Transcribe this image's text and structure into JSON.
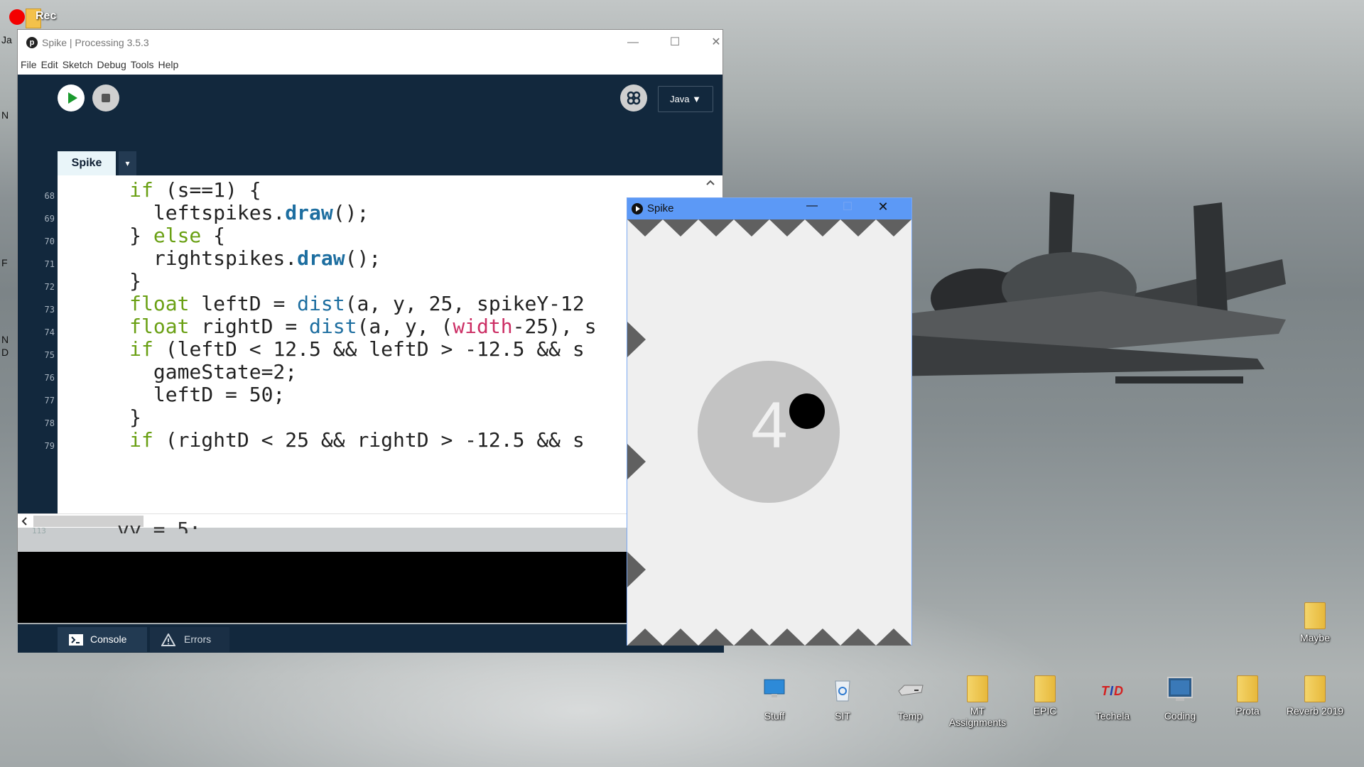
{
  "desktop": {
    "rec_label": "Rec",
    "left_fragments": [
      "Ja",
      "N",
      "F",
      "N",
      "D"
    ],
    "icons": [
      {
        "name": "Stuff",
        "icon": "computer-icon"
      },
      {
        "name": "SIT",
        "icon": "recycle-bin-icon"
      },
      {
        "name": "Temp",
        "icon": "drive-icon"
      },
      {
        "name": "MT Assignments",
        "icon": "folder-icon"
      },
      {
        "name": "EPIC",
        "icon": "folder-icon"
      },
      {
        "name": "Techela",
        "icon": "techela-icon"
      },
      {
        "name": "Coding",
        "icon": "monitor-icon"
      },
      {
        "name": "Prota",
        "icon": "folder-icon"
      },
      {
        "name": "Reverb 2019",
        "icon": "folder-icon"
      },
      {
        "name": "Maybe",
        "icon": "folder-icon"
      }
    ]
  },
  "ide": {
    "title": "Spike | Processing 3.5.3",
    "menu": [
      "File",
      "Edit",
      "Sketch",
      "Debug",
      "Tools",
      "Help"
    ],
    "mode": "Java ▼",
    "tab": "Spike",
    "tab_menu": "▾",
    "line_numbers": [
      "68",
      "69",
      "70",
      "71",
      "72",
      "73",
      "74",
      "75",
      "76",
      "77",
      "78",
      "79"
    ],
    "ghost_line_number": "113",
    "ghost_code": "vy = 5;",
    "code": {
      "l68": {
        "a": "      ",
        "b": "if",
        "c": " (s==1) {"
      },
      "l69": {
        "a": "        leftspikes.",
        "b": "draw",
        "c": "();"
      },
      "l70": {
        "a": "      } ",
        "b": "else",
        "c": " {"
      },
      "l71": {
        "a": "        rightspikes.",
        "b": "draw",
        "c": "();"
      },
      "l72": {
        "a": "      }"
      },
      "l73": {
        "a": "      ",
        "b": "float",
        "c": " leftD = ",
        "d": "dist",
        "e": "(a, y, 25, spikeY-12"
      },
      "l74": {
        "a": "      ",
        "b": "float",
        "c": " rightD = ",
        "d": "dist",
        "e": "(a, y, (",
        "f": "width",
        "g": "-25), s"
      },
      "l75": {
        "a": "      ",
        "b": "if",
        "c": " (leftD < 12.5 && leftD > -12.5 && s"
      },
      "l76": {
        "a": "        gameState=2;"
      },
      "l77": {
        "a": "        leftD = 50;"
      },
      "l78": {
        "a": "      }"
      },
      "l79": {
        "a": "      ",
        "b": "if",
        "c": " (rightD < 25 && rightD > -12.5 && s"
      }
    },
    "console_tab": "Console",
    "errors_tab": "Errors"
  },
  "sketch": {
    "title": "Spike",
    "score": "4"
  }
}
